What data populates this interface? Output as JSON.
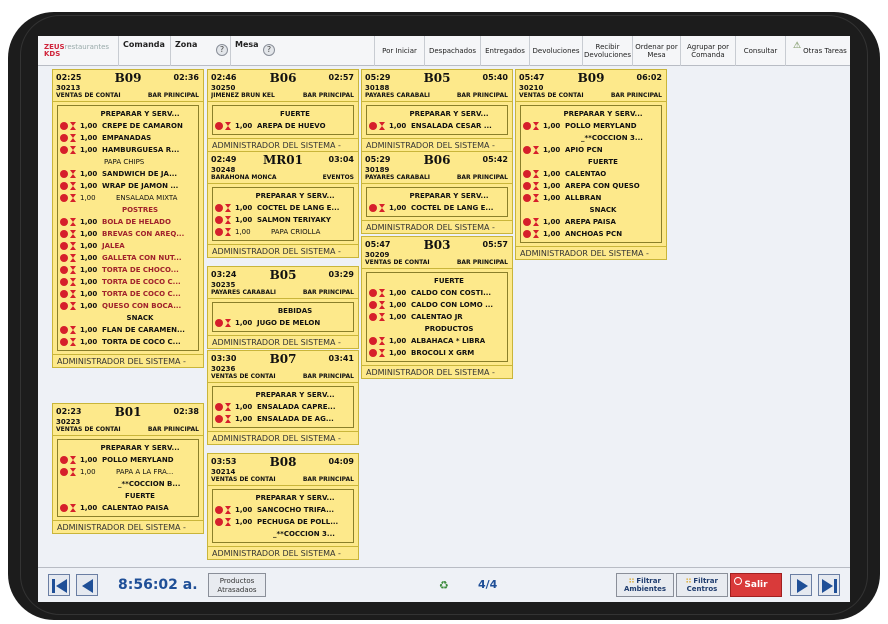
{
  "app": {
    "logo_brand": "ZEUS",
    "logo_sub": "restaurantes",
    "logo_product": "KDS"
  },
  "topbar": {
    "comanda": "Comanda",
    "zona": "Zona",
    "mesa": "Mesa",
    "help": "?",
    "buttons": [
      {
        "label": "Por Iniciar"
      },
      {
        "label": "Despachados"
      },
      {
        "label": "Entregados"
      },
      {
        "label": "Devoluciones"
      },
      {
        "label": "Recibir Devoluciones"
      },
      {
        "label": "Ordenar por Mesa"
      },
      {
        "label": "Agrupar por Comanda"
      },
      {
        "label": "Consultar"
      },
      {
        "label": "Otras Tareas"
      }
    ]
  },
  "footer_text": "ADMINISTRADOR DEL SISTEMA -",
  "cards": [
    {
      "time_start": "02:25",
      "table": "B09",
      "time_end": "02:36",
      "order": "30213",
      "client": "VENTAS DE CONTAI",
      "area": "BAR PRINCIPAL",
      "lines": [
        {
          "k": "sec",
          "text": "PREPARAR Y SERV..."
        },
        {
          "k": "it",
          "qty": "1,00",
          "name": "CREPE DE CAMARON"
        },
        {
          "k": "it",
          "qty": "1,00",
          "name": "EMPANADAS"
        },
        {
          "k": "it",
          "qty": "1,00",
          "name": "HAMBURGUESA R..."
        },
        {
          "k": "sub",
          "qty": "",
          "name": "PAPA CHIPS"
        },
        {
          "k": "it",
          "qty": "1,00",
          "name": "SANDWICH DE JA..."
        },
        {
          "k": "it",
          "qty": "1,00",
          "name": "WRAP DE JAMON ..."
        },
        {
          "k": "itsub",
          "qty": "1,00",
          "name": "ENSALADA MIXTA"
        },
        {
          "k": "secred",
          "text": "POSTRES"
        },
        {
          "k": "itred",
          "qty": "1,00",
          "name": "BOLA DE HELADO"
        },
        {
          "k": "itred",
          "qty": "1,00",
          "name": "BREVAS CON AREQ..."
        },
        {
          "k": "itred",
          "qty": "1,00",
          "name": "JALEA"
        },
        {
          "k": "itred",
          "qty": "1,00",
          "name": "GALLETA CON NUT..."
        },
        {
          "k": "itred",
          "qty": "1,00",
          "name": "TORTA DE CHOCO..."
        },
        {
          "k": "itred",
          "qty": "1,00",
          "name": "TORTA DE COCO C..."
        },
        {
          "k": "itred",
          "qty": "1,00",
          "name": "TORTA DE COCO C..."
        },
        {
          "k": "itred",
          "qty": "1,00",
          "name": "QUESO CON BOCA..."
        },
        {
          "k": "sec",
          "text": "SNACK"
        },
        {
          "k": "it",
          "qty": "1,00",
          "name": "FLAN DE CARAMEN..."
        },
        {
          "k": "it",
          "qty": "1,00",
          "name": "TORTA DE COCO C..."
        }
      ]
    },
    {
      "time_start": "02:23",
      "table": "B01",
      "time_end": "02:38",
      "order": "30223",
      "client": "VENTAS DE CONTAI",
      "area": "BAR PRINCIPAL",
      "lines": [
        {
          "k": "sec",
          "text": "PREPARAR Y SERV..."
        },
        {
          "k": "it",
          "qty": "1,00",
          "name": "POLLO MERYLAND"
        },
        {
          "k": "itsub",
          "qty": "1,00",
          "name": "PAPA A LA FRA..."
        },
        {
          "k": "mod",
          "text": "_**COCCION B..."
        },
        {
          "k": "sec",
          "text": "FUERTE"
        },
        {
          "k": "it",
          "qty": "1,00",
          "name": "CALENTAO PAISA"
        }
      ]
    },
    {
      "time_start": "02:46",
      "table": "B06",
      "time_end": "02:57",
      "order": "30250",
      "client": "JIMENEZ BRUN KEL",
      "area": "BAR PRINCIPAL",
      "lines": [
        {
          "k": "sec",
          "text": "FUERTE"
        },
        {
          "k": "it",
          "qty": "1,00",
          "name": "AREPA DE HUEVO"
        }
      ]
    },
    {
      "time_start": "02:49",
      "table": "MR01",
      "time_end": "03:04",
      "order": "30248",
      "client": "BARAHONA MONCA",
      "area": "EVENTOS",
      "lines": [
        {
          "k": "sec",
          "text": "PREPARAR Y SERV..."
        },
        {
          "k": "it",
          "qty": "1,00",
          "name": "COCTEL DE LANG E..."
        },
        {
          "k": "it",
          "qty": "1,00",
          "name": "SALMON TERIYAKY"
        },
        {
          "k": "itsub",
          "qty": "1,00",
          "name": "PAPA CRIOLLA"
        }
      ]
    },
    {
      "time_start": "03:24",
      "table": "B05",
      "time_end": "03:29",
      "order": "30235",
      "client": "PAYARES CARABALI",
      "area": "BAR PRINCIPAL",
      "lines": [
        {
          "k": "sec",
          "text": "BEBIDAS"
        },
        {
          "k": "it",
          "qty": "1,00",
          "name": "JUGO DE MELON"
        }
      ]
    },
    {
      "time_start": "03:30",
      "table": "B07",
      "time_end": "03:41",
      "order": "30236",
      "client": "VENTAS DE CONTAI",
      "area": "BAR PRINCIPAL",
      "lines": [
        {
          "k": "sec",
          "text": "PREPARAR Y SERV..."
        },
        {
          "k": "it",
          "qty": "1,00",
          "name": "ENSALADA CAPRE..."
        },
        {
          "k": "it",
          "qty": "1,00",
          "name": "ENSALADA DE AG..."
        }
      ]
    },
    {
      "time_start": "03:53",
      "table": "B08",
      "time_end": "04:09",
      "order": "30214",
      "client": "VENTAS DE CONTAI",
      "area": "BAR PRINCIPAL",
      "lines": [
        {
          "k": "sec",
          "text": "PREPARAR Y SERV..."
        },
        {
          "k": "it",
          "qty": "1,00",
          "name": "SANCOCHO TRIFA..."
        },
        {
          "k": "it",
          "qty": "1,00",
          "name": "PECHUGA DE POLL..."
        },
        {
          "k": "mod",
          "text": "_**COCCION 3..."
        }
      ]
    },
    {
      "time_start": "05:29",
      "table": "B05",
      "time_end": "05:40",
      "order": "30188",
      "client": "PAYARES CARABALI",
      "area": "BAR PRINCIPAL",
      "lines": [
        {
          "k": "sec",
          "text": "PREPARAR Y SERV..."
        },
        {
          "k": "it",
          "qty": "1,00",
          "name": "ENSALADA CESAR ..."
        }
      ]
    },
    {
      "time_start": "05:29",
      "table": "B06",
      "time_end": "05:42",
      "order": "30189",
      "client": "PAYARES CARABALI",
      "area": "BAR PRINCIPAL",
      "lines": [
        {
          "k": "sec",
          "text": "PREPARAR Y SERV..."
        },
        {
          "k": "it",
          "qty": "1,00",
          "name": "COCTEL DE LANG E..."
        }
      ]
    },
    {
      "time_start": "05:47",
      "table": "B03",
      "time_end": "05:57",
      "order": "30209",
      "client": "VENTAS DE CONTAI",
      "area": "BAR PRINCIPAL",
      "lines": [
        {
          "k": "sec",
          "text": "FUERTE"
        },
        {
          "k": "it",
          "qty": "1,00",
          "name": "CALDO CON COSTI..."
        },
        {
          "k": "it",
          "qty": "1,00",
          "name": "CALDO CON LOMO ..."
        },
        {
          "k": "it",
          "qty": "1,00",
          "name": "CALENTAO JR"
        },
        {
          "k": "sec",
          "text": "PRODUCTOS"
        },
        {
          "k": "it",
          "qty": "1,00",
          "name": "ALBAHACA * LIBRA"
        },
        {
          "k": "it",
          "qty": "1,00",
          "name": "BROCOLI X GRM"
        }
      ]
    },
    {
      "time_start": "05:47",
      "table": "B09",
      "time_end": "06:02",
      "order": "30210",
      "client": "VENTAS DE CONTAI",
      "area": "BAR PRINCIPAL",
      "lines": [
        {
          "k": "sec",
          "text": "PREPARAR Y SERV..."
        },
        {
          "k": "it",
          "qty": "1,00",
          "name": "POLLO MERYLAND"
        },
        {
          "k": "mod",
          "text": "_**COCCION 3..."
        },
        {
          "k": "it",
          "qty": "1,00",
          "name": "APIO PCN"
        },
        {
          "k": "sec",
          "text": "FUERTE"
        },
        {
          "k": "it",
          "qty": "1,00",
          "name": "CALENTAO"
        },
        {
          "k": "it",
          "qty": "1,00",
          "name": "AREPA CON QUESO"
        },
        {
          "k": "it",
          "qty": "1,00",
          "name": "ALLBRAN"
        },
        {
          "k": "sec",
          "text": "SNACK"
        },
        {
          "k": "it",
          "qty": "1,00",
          "name": "AREPA PAISA"
        },
        {
          "k": "it",
          "qty": "1,00",
          "name": "ANCHOAS PCN"
        }
      ]
    }
  ],
  "bottombar": {
    "clock": "8:56:02 a.",
    "productos_atrasados": "Productos Atrasadaos",
    "pages": "4/4",
    "filtrar_ambientes": "Filtrar Ambientes",
    "filtrar_centros": "Filtrar Centros",
    "salir": "Salir"
  },
  "colors": {
    "card_bg": "#fde98b",
    "accent": "#1f4f97",
    "alert": "#d61f2b",
    "salir": "#d93a3a"
  }
}
